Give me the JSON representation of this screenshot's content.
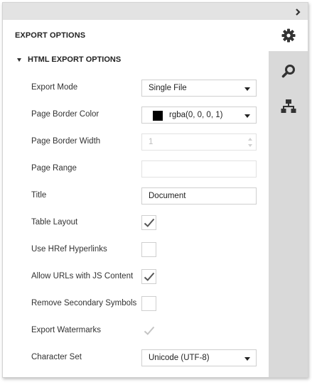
{
  "panel": {
    "title": "EXPORT OPTIONS",
    "section_title": "HTML EXPORT OPTIONS"
  },
  "side_tabs": [
    {
      "icon": "gear-icon",
      "active": true
    },
    {
      "icon": "search-icon",
      "active": false
    },
    {
      "icon": "document-map-icon",
      "active": false
    }
  ],
  "options": {
    "export_mode": {
      "label": "Export Mode",
      "value": "Single File"
    },
    "page_border_color": {
      "label": "Page Border Color",
      "value": "rgba(0, 0, 0, 1)",
      "swatch_color": "#000000"
    },
    "page_border_width": {
      "label": "Page Border Width",
      "value": "1"
    },
    "page_range": {
      "label": "Page Range",
      "value": ""
    },
    "title": {
      "label": "Title",
      "value": "Document"
    },
    "table_layout": {
      "label": "Table Layout",
      "checked": true
    },
    "use_href_hyperlinks": {
      "label": "Use HRef Hyperlinks",
      "checked": false
    },
    "allow_urls_js": {
      "label": "Allow URLs with JS Content",
      "checked": true
    },
    "remove_secondary_symbols": {
      "label": "Remove Secondary Symbols",
      "checked": false
    },
    "export_watermarks": {
      "label": "Export Watermarks",
      "checked": true,
      "disabled": true
    },
    "character_set": {
      "label": "Character Set",
      "value": "Unicode (UTF-8)"
    }
  },
  "colors": {
    "tab_bar": "#d9d9d9",
    "top_bar": "#e3e3e3",
    "icon": "#333333",
    "check": "#555555",
    "check_disabled": "#c4c4c4"
  }
}
